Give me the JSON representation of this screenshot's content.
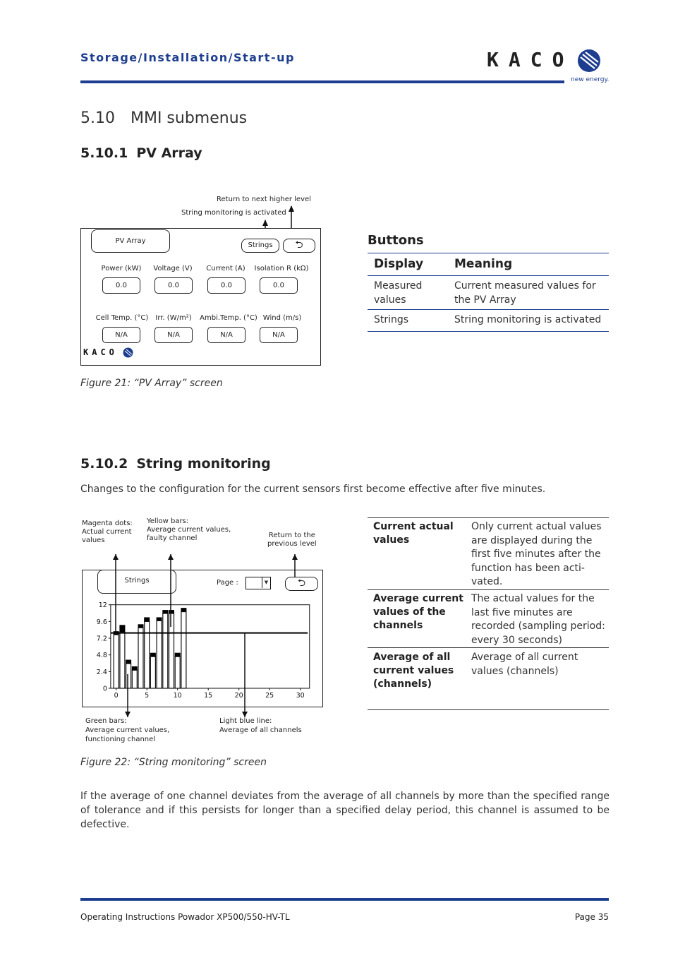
{
  "header": {
    "section_path": "Storage/Installation/Start-up",
    "logo_text": "KACO",
    "logo_tagline": "new energy."
  },
  "section": {
    "number": "5.10",
    "title": "MMI submenus"
  },
  "sub1": {
    "number": "5.10.1",
    "title": "PV Array"
  },
  "fig21": {
    "annot_return": "Return to next higher level",
    "annot_strings": "String monitoring is activated",
    "title_button": "PV Array",
    "strings_button": "Strings",
    "back_icon": "return-arrow-icon",
    "fields": [
      {
        "label": "Power (kW)",
        "value": "0.0"
      },
      {
        "label": "Voltage (V)",
        "value": "0.0"
      },
      {
        "label": "Current (A)",
        "value": "0.0"
      },
      {
        "label": "Isolation R (kΩ)",
        "value": "0.0"
      },
      {
        "label": "Cell Temp. (°C)",
        "value": "N/A"
      },
      {
        "label": "Irr. (W/m²)",
        "value": "N/A"
      },
      {
        "label": "Ambi.Temp. (°C)",
        "value": "N/A"
      },
      {
        "label": "Wind (m/s)",
        "value": "N/A"
      }
    ],
    "logo_text": "KACO",
    "caption": "Figure 21:   “PV Array” screen"
  },
  "buttons_table": {
    "heading": "Buttons",
    "col_display": "Display",
    "col_meaning": "Meaning",
    "rows": [
      {
        "display": "Measured values",
        "meaning": "Current measured values for the PV Array"
      },
      {
        "display": "Strings",
        "meaning": "String monitoring is activated"
      }
    ]
  },
  "sub2": {
    "number": "5.10.2",
    "title": "String monitoring",
    "intro": "Changes to the configuration for the current sensors first become effective after five minutes."
  },
  "fig22": {
    "annot_magenta": "Magenta dots:\nActual current\nvalues",
    "annot_yellow": "Yellow bars:\nAverage current values,\nfaulty channel",
    "annot_return": "Return to the\nprevious level",
    "annot_green": "Green bars:\nAverage current values,\nfunctioning channel",
    "annot_blue": "Light blue line:\nAverage of all channels",
    "strings_button": "Strings",
    "page_label": "Page :",
    "caption": "Figure 22:   “String monitoring” screen"
  },
  "chart_data": {
    "type": "bar",
    "x": [
      0,
      1,
      2,
      3,
      4,
      5,
      6,
      7,
      8,
      9,
      10,
      11
    ],
    "series": [
      {
        "name": "Average current values",
        "values": [
          7.7,
          8.1,
          3.55,
          2.6,
          8.7,
          9.6,
          4.55,
          9.7,
          10.75,
          10.75,
          4.55,
          11.0
        ]
      },
      {
        "name": "Actual current values",
        "values": [
          8.2,
          9.1,
          4.1,
          3.15,
          9.2,
          10.2,
          5.1,
          10.2,
          11.25,
          11.25,
          5.1,
          11.55
        ]
      }
    ],
    "average_line": 7.95,
    "xlim": [
      -0.9,
      31.5
    ],
    "ylim": [
      0,
      12
    ],
    "xticks": [
      0,
      5,
      10,
      15,
      20,
      25,
      30
    ],
    "yticks": [
      "0",
      "2.4",
      "4.8",
      "7.2",
      "9.6",
      "12"
    ],
    "colors": {
      "bars": "#ffffff",
      "markers": "#000000",
      "line": "#000000"
    }
  },
  "right_table2": {
    "rows": [
      {
        "term": "Current actual values",
        "desc": "Only current actual values are displayed during the first five minutes after the function has been acti-vated."
      },
      {
        "term": "Average current values of the channels",
        "desc": "The actual values for the last five minutes are recorded (sampling period: every 30 seconds)"
      },
      {
        "term": "Average of all current values (channels)",
        "desc": "Average of all current values (channels)"
      }
    ]
  },
  "closing": "If the average of one channel deviates from the average of all channels by more than the specified range of tolerance and if this persists for longer than a specified delay period, this channel is assumed to be defective.",
  "footer": {
    "doc": "Operating Instructions Powador XP500/550-HV-TL",
    "page": "Page 35"
  }
}
